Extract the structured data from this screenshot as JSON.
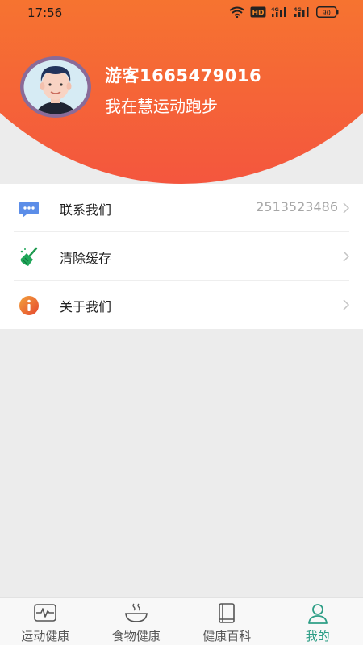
{
  "status_bar": {
    "time": "17:56",
    "network_labels": [
      "HD",
      "4G",
      "4G"
    ],
    "battery": "90"
  },
  "profile": {
    "username": "游客1665479016",
    "subtitle": "我在慧运动跑步"
  },
  "menu": {
    "items": [
      {
        "label": "联系我们",
        "value": "2513523486",
        "icon": "message-bubble-icon"
      },
      {
        "label": "清除缓存",
        "value": "",
        "icon": "broom-icon"
      },
      {
        "label": "关于我们",
        "value": "",
        "icon": "info-icon"
      }
    ]
  },
  "tabbar": {
    "tabs": [
      {
        "label": "运动健康",
        "icon": "heartbeat-monitor-icon",
        "active": false
      },
      {
        "label": "食物健康",
        "icon": "bowl-icon",
        "active": false
      },
      {
        "label": "健康百科",
        "icon": "book-icon",
        "active": false
      },
      {
        "label": "我的",
        "icon": "person-icon",
        "active": true
      }
    ]
  },
  "colors": {
    "header_gradient_top": "#f58a2c",
    "header_gradient_bottom": "#f4563e",
    "active_tab": "#2e9e86",
    "menu_value": "#a6a6a6"
  }
}
